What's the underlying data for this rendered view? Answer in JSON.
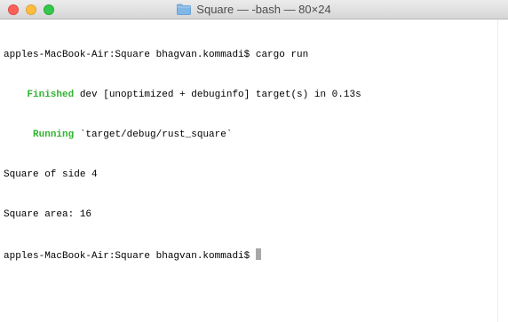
{
  "window": {
    "title": "Square — -bash — 80×24",
    "folder_icon": "folder-icon",
    "close_color": "#fc605b",
    "minimize_color": "#fdbc40",
    "maximize_color": "#34c84a"
  },
  "terminal": {
    "lines": [
      {
        "prefix": "",
        "status": "",
        "text": "apples-MacBook-Air:Square bhagvan.kommadi$ cargo run"
      },
      {
        "prefix": "    ",
        "status": "Finished",
        "text": " dev [unoptimized + debuginfo] target(s) in 0.13s"
      },
      {
        "prefix": "     ",
        "status": "Running",
        "text": " `target/debug/rust_square`"
      },
      {
        "prefix": "",
        "status": "",
        "text": "Square of side 4"
      },
      {
        "prefix": "",
        "status": "",
        "text": "Square area: 16"
      }
    ],
    "prompt": "apples-MacBook-Air:Square bhagvan.kommadi$ ",
    "status_color": "#2fb42f"
  }
}
